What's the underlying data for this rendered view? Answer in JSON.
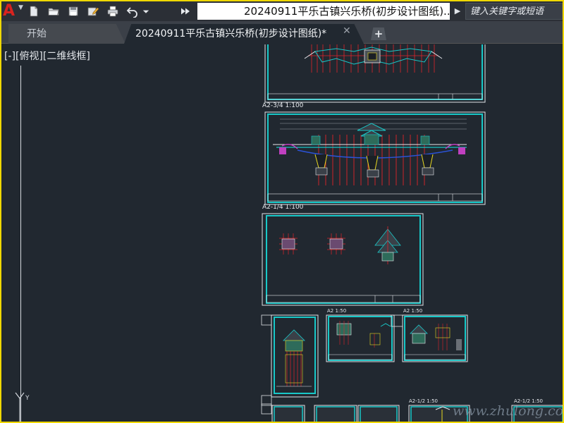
{
  "app": {
    "logo": "A",
    "document_title": "20240911平乐古镇兴乐桥(初步设计图纸)....",
    "search_placeholder": "键入关键字或短语"
  },
  "tabs": [
    {
      "label": "开始"
    },
    {
      "label": "20240911平乐古镇兴乐桥(初步设计图纸)*"
    }
  ],
  "tab_close_glyph": "✕",
  "tab_add_glyph": "+",
  "viewport": {
    "view_label": "[-][俯视][二维线框]",
    "sheet_labels": [
      "A2-3/4 1:100",
      "A2-1/4 1:100",
      "A2 1:50",
      "A2 1:50",
      "A2-1/2 1:50",
      "A2-1/2 1:50"
    ],
    "ucs_y_label": "Y"
  },
  "watermark": "www.zhulong.com",
  "icons": [
    "app-logo-icon",
    "new-file-icon",
    "open-folder-icon",
    "save-icon",
    "save-as-icon",
    "print-icon",
    "undo-icon",
    "dropdown-icon",
    "more-icon"
  ],
  "colors": {
    "canvas": "#212830",
    "sheet_border": "#18c8c8",
    "red_lines": "#e0242a",
    "yellow_lines": "#e8d820",
    "frame": "#f0d800"
  }
}
